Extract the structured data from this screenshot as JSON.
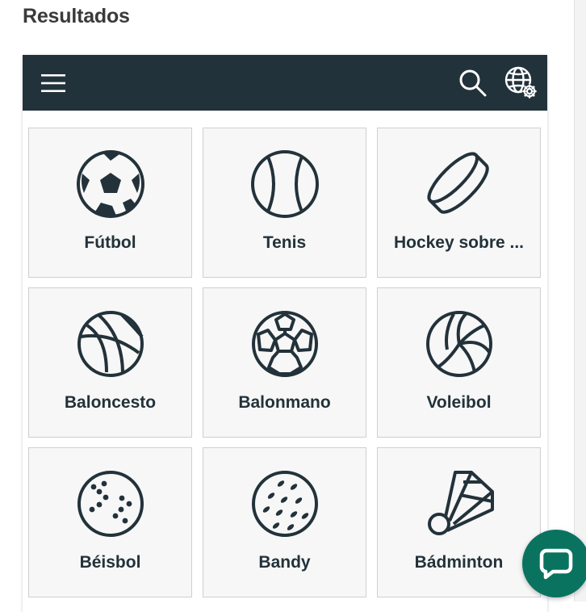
{
  "page": {
    "title": "Resultados"
  },
  "topbar": {
    "menu_icon": "hamburger-menu-icon",
    "search_icon": "search-icon",
    "settings_icon": "globe-settings-icon",
    "background": "#22323b"
  },
  "sports": [
    {
      "label": "Fútbol",
      "icon": "soccer-ball-icon"
    },
    {
      "label": "Tenis",
      "icon": "tennis-ball-icon"
    },
    {
      "label": "Hockey sobre ...",
      "icon": "hockey-puck-icon"
    },
    {
      "label": "Baloncesto",
      "icon": "basketball-icon"
    },
    {
      "label": "Balonmano",
      "icon": "handball-icon"
    },
    {
      "label": "Voleibol",
      "icon": "volleyball-icon"
    },
    {
      "label": "Béisbol",
      "icon": "baseball-icon"
    },
    {
      "label": "Bandy",
      "icon": "bandy-ball-icon"
    },
    {
      "label": "Bádminton",
      "icon": "shuttlecock-icon"
    }
  ],
  "chat": {
    "icon": "chat-bubble-icon",
    "color": "#0a7360"
  }
}
